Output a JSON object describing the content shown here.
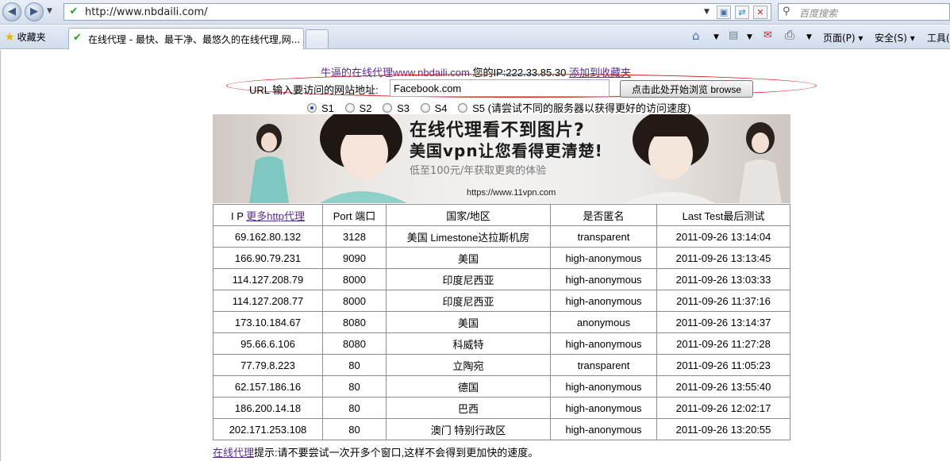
{
  "browser": {
    "address_url": "http://www.nbdaili.com/",
    "search_placeholder": "百度搜索",
    "favorites_label": "收藏夹",
    "tab_title": "在线代理 - 最快、最干净、最悠久的在线代理,网...",
    "menu": {
      "page": "页面(P)",
      "safety": "安全(S)",
      "tools": "工具("
    },
    "icons": [
      "back-icon",
      "forward-icon",
      "refresh-icon",
      "stop-icon",
      "search-icon",
      "home-icon",
      "feed-icon",
      "mail-icon",
      "print-icon",
      "star-icon"
    ]
  },
  "page": {
    "top_line": {
      "site_link": "牛逼的在线代理www.nbdaili.com",
      "ip_text": "您的IP:222.33.85.30",
      "bookmark_link": "添加到收藏夹"
    },
    "url_form": {
      "label": "URL 输入要访问的网站地址:",
      "value": "Facebook.com",
      "button": "点击此处开始浏览 browse"
    },
    "servers": {
      "options": [
        "S1",
        "S2",
        "S3",
        "S4",
        "S5"
      ],
      "selected": "S1",
      "hint": "(请尝试不同的服务器以获得更好的访问速度)"
    },
    "banner": {
      "headline": "在线代理看不到图片?",
      "subheadline": "美国vpn让您看得更清楚!",
      "price": "低至100元/年获取更爽的体验",
      "url": "https://www.11vpn.com"
    },
    "table": {
      "headers": {
        "ip_prefix": "I P",
        "ip_link": "更多http代理",
        "port": "Port 端口",
        "country": "国家/地区",
        "anon": "是否匿名",
        "last_test": "Last Test最后测试"
      },
      "rows": [
        [
          "69.162.80.132",
          "3128",
          "美国 Limestone达拉斯机房",
          "transparent",
          "2011-09-26 13:14:04"
        ],
        [
          "166.90.79.231",
          "9090",
          "美国",
          "high-anonymous",
          "2011-09-26 13:13:45"
        ],
        [
          "114.127.208.79",
          "8000",
          "印度尼西亚",
          "high-anonymous",
          "2011-09-26 13:03:33"
        ],
        [
          "114.127.208.77",
          "8000",
          "印度尼西亚",
          "high-anonymous",
          "2011-09-26 11:37:16"
        ],
        [
          "173.10.184.67",
          "8080",
          "美国",
          "anonymous",
          "2011-09-26 13:14:37"
        ],
        [
          "95.66.6.106",
          "8080",
          "科威特",
          "high-anonymous",
          "2011-09-26 11:27:28"
        ],
        [
          "77.79.8.223",
          "80",
          "立陶宛",
          "transparent",
          "2011-09-26 11:05:23"
        ],
        [
          "62.157.186.16",
          "80",
          "德国",
          "high-anonymous",
          "2011-09-26 13:55:40"
        ],
        [
          "186.200.14.18",
          "80",
          "巴西",
          "high-anonymous",
          "2011-09-26 12:02:17"
        ],
        [
          "202.171.253.108",
          "80",
          "澳门 特别行政区",
          "high-anonymous",
          "2011-09-26 13:20:55"
        ]
      ]
    },
    "footer": {
      "link": "在线代理",
      "text": "提示:请不要尝试一次开多个窗口,这样不会得到更加快的速度。"
    },
    "colors": {
      "link_visited": "#5b2c8e",
      "oval": "#d01818",
      "favicon": "#24a02c"
    }
  }
}
